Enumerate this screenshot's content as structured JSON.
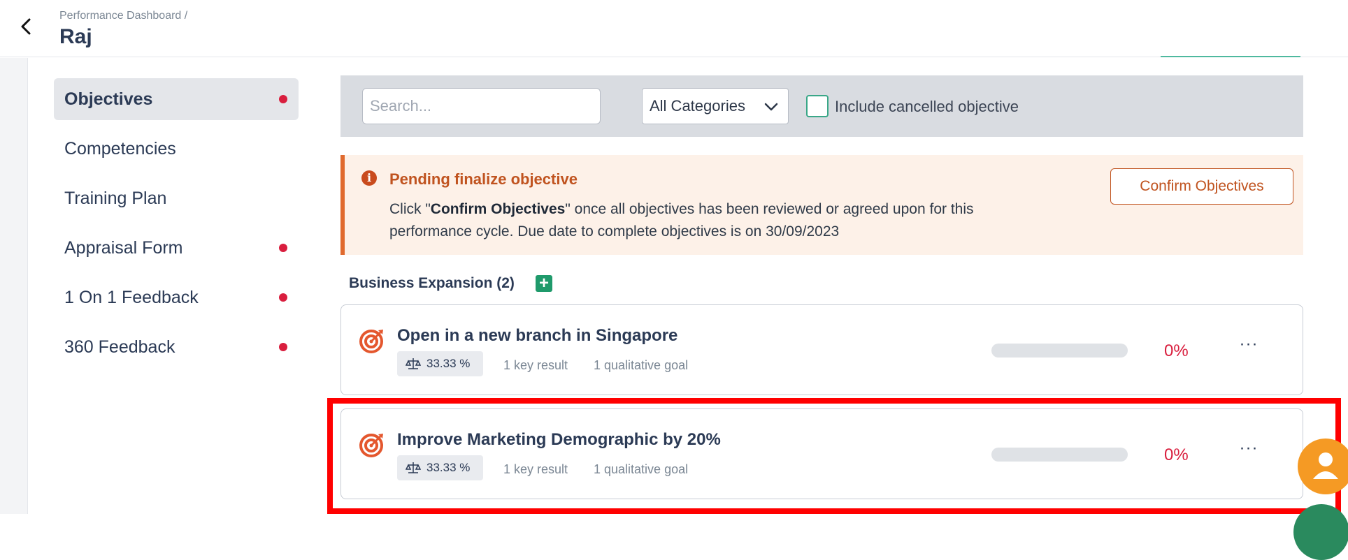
{
  "header": {
    "breadcrumb": "Performance Dashboard /",
    "title": "Raj"
  },
  "sidebar": {
    "items": [
      {
        "label": "Objectives",
        "active": true,
        "dot": true
      },
      {
        "label": "Competencies",
        "active": false,
        "dot": false
      },
      {
        "label": "Training Plan",
        "active": false,
        "dot": false
      },
      {
        "label": "Appraisal Form",
        "active": false,
        "dot": true
      },
      {
        "label": "1 On 1 Feedback",
        "active": false,
        "dot": true
      },
      {
        "label": "360 Feedback",
        "active": false,
        "dot": true
      }
    ]
  },
  "filters": {
    "search_placeholder": "Search...",
    "category_value": "All Categories",
    "include_cancelled_label": "Include cancelled objective",
    "include_cancelled_checked": false
  },
  "alert": {
    "title": "Pending finalize objective",
    "text_prefix": "Click \"",
    "text_bold": "Confirm Objectives",
    "text_suffix": "\" once all objectives has been reviewed or agreed upon for this performance cycle. Due date to complete objectives is on 30/09/2023",
    "confirm_label": "Confirm Objectives"
  },
  "group": {
    "title": "Business Expansion (2)",
    "add_symbol": "+"
  },
  "objectives": [
    {
      "title": "Open in a new branch in Singapore",
      "weight": "33.33 %",
      "key_results": "1 key result",
      "qualitative": "1 qualitative goal",
      "progress": 0,
      "percent": "0%",
      "more": "···"
    },
    {
      "title": "Improve Marketing Demographic by 20%",
      "weight": "33.33 %",
      "key_results": "1 key result",
      "qualitative": "1 qualitative goal",
      "progress": 0,
      "percent": "0%",
      "more": "···"
    }
  ],
  "colors": {
    "accent_green": "#1f9a6b",
    "alert_orange": "#c0531f",
    "danger_red": "#d91e3e",
    "highlight_red": "#ff0000"
  }
}
